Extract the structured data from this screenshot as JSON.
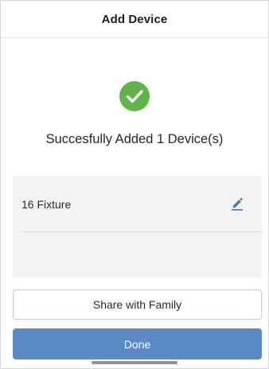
{
  "header": {
    "title": "Add Device"
  },
  "success": {
    "icon": "checkmark-circle-icon",
    "icon_color": "#5fb44a",
    "message": "Succesfully Added 1 Device(s)"
  },
  "devices": [
    {
      "name": "16 Fixture",
      "edit_icon": "pencil-edit-icon"
    }
  ],
  "actions": {
    "share_label": "Share with Family",
    "done_label": "Done"
  },
  "colors": {
    "primary": "#5b8ac5",
    "success": "#5fb44a",
    "edit_icon": "#3d7dc4"
  }
}
